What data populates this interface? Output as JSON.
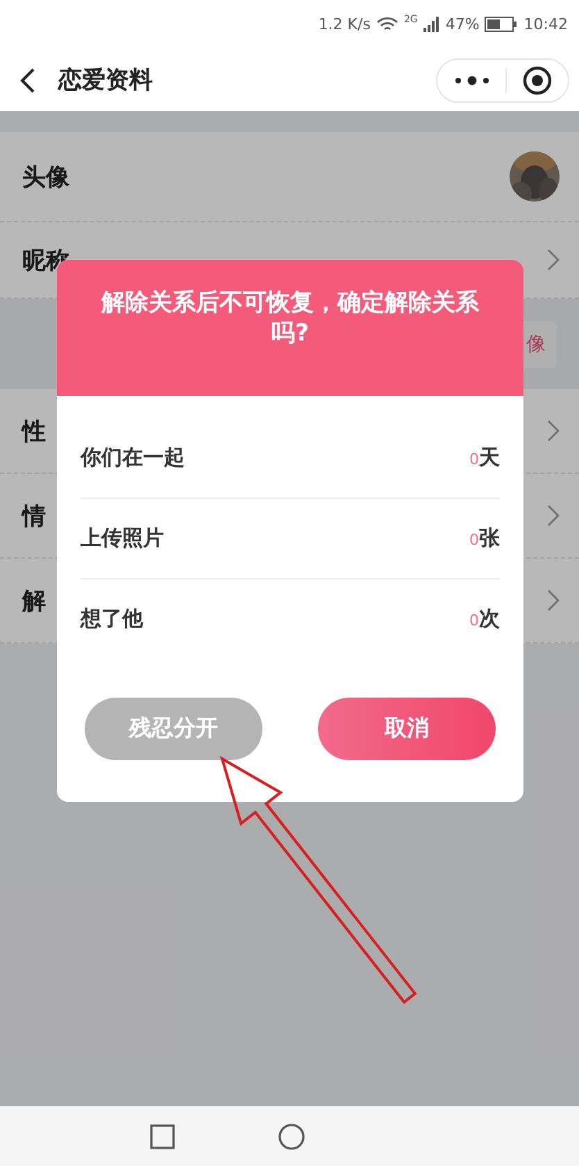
{
  "status_bar": {
    "speed": "1.2 K/s",
    "network": "2G",
    "battery": "47%",
    "time": "10:42"
  },
  "header": {
    "title": "恋爱资料"
  },
  "rows": [
    {
      "kind": "avatar",
      "label": "头像"
    },
    {
      "kind": "text",
      "label": "昵称"
    },
    {
      "kind": "band",
      "badge": "像"
    },
    {
      "kind": "arrow",
      "label": "性"
    },
    {
      "kind": "arrow",
      "label": "情"
    },
    {
      "kind": "arrow",
      "label": "解"
    }
  ],
  "dialog": {
    "title": "解除关系后不可恢复，确定解除关系吗?",
    "stats": [
      {
        "label": "你们在一起",
        "count": "0",
        "unit": "天"
      },
      {
        "label": "上传照片",
        "count": "0",
        "unit": "张"
      },
      {
        "label": "想了他",
        "count": "0",
        "unit": "次"
      }
    ],
    "buttons": [
      {
        "label": "残忍分开",
        "kind": "secondary"
      },
      {
        "label": "取消",
        "kind": "primary"
      }
    ]
  }
}
